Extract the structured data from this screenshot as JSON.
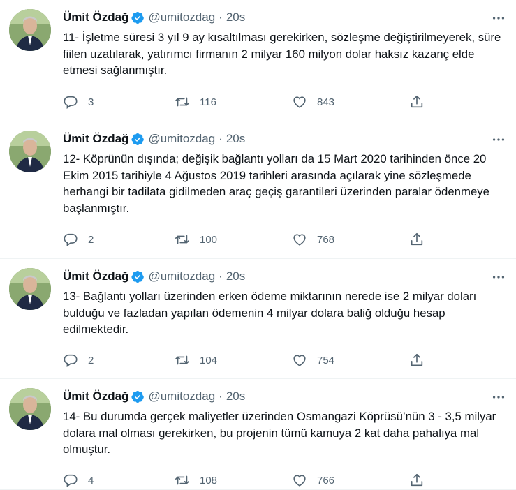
{
  "tweets": [
    {
      "author": "Ümit Özdağ",
      "handle": "@umitozdag",
      "dot": "·",
      "time": "20s",
      "text": "11- İşletme süresi 3 yıl 9 ay kısaltılması gerekirken, sözleşme değiştirilmeyerek, süre fiilen uzatılarak, yatırımcı firmanın 2 milyar 160 milyon dolar haksız kazanç elde etmesi sağlanmıştır.",
      "replies": "3",
      "retweets": "116",
      "likes": "843"
    },
    {
      "author": "Ümit Özdağ",
      "handle": "@umitozdag",
      "dot": "·",
      "time": "20s",
      "text": "12- Köprünün dışında; değişik bağlantı yolları da 15 Mart 2020 tarihinden önce 20 Ekim 2015 tarihiyle 4 Ağustos 2019 tarihleri arasında açılarak yine sözleşmede herhangi bir tadilata gidilmeden araç geçiş garantileri üzerinden paralar ödenmeye başlanmıştır.",
      "replies": "2",
      "retweets": "100",
      "likes": "768"
    },
    {
      "author": "Ümit Özdağ",
      "handle": "@umitozdag",
      "dot": "·",
      "time": "20s",
      "text": "13- Bağlantı yolları üzerinden erken ödeme miktarının nerede ise 2 milyar doları bulduğu ve fazladan yapılan ödemenin 4 milyar dolara baliğ olduğu hesap edilmektedir.",
      "replies": "2",
      "retweets": "104",
      "likes": "754"
    },
    {
      "author": "Ümit Özdağ",
      "handle": "@umitozdag",
      "dot": "·",
      "time": "20s",
      "text": "14- Bu durumda gerçek maliyetler üzerinden Osmangazi Köprüsü’nün 3 - 3,5 milyar dolara mal olması gerekirken, bu projenin tümü kamuya 2 kat daha pahalıya mal olmuştur.",
      "replies": "4",
      "retweets": "108",
      "likes": "766"
    }
  ],
  "icons": {
    "verified": "verified-badge-icon",
    "more": "more-options-icon",
    "reply": "reply-icon",
    "retweet": "retweet-icon",
    "like": "like-icon",
    "share": "share-icon"
  },
  "colors": {
    "verified": "#1d9bf0",
    "secondary_text": "#536471",
    "primary_text": "#0f1419"
  }
}
